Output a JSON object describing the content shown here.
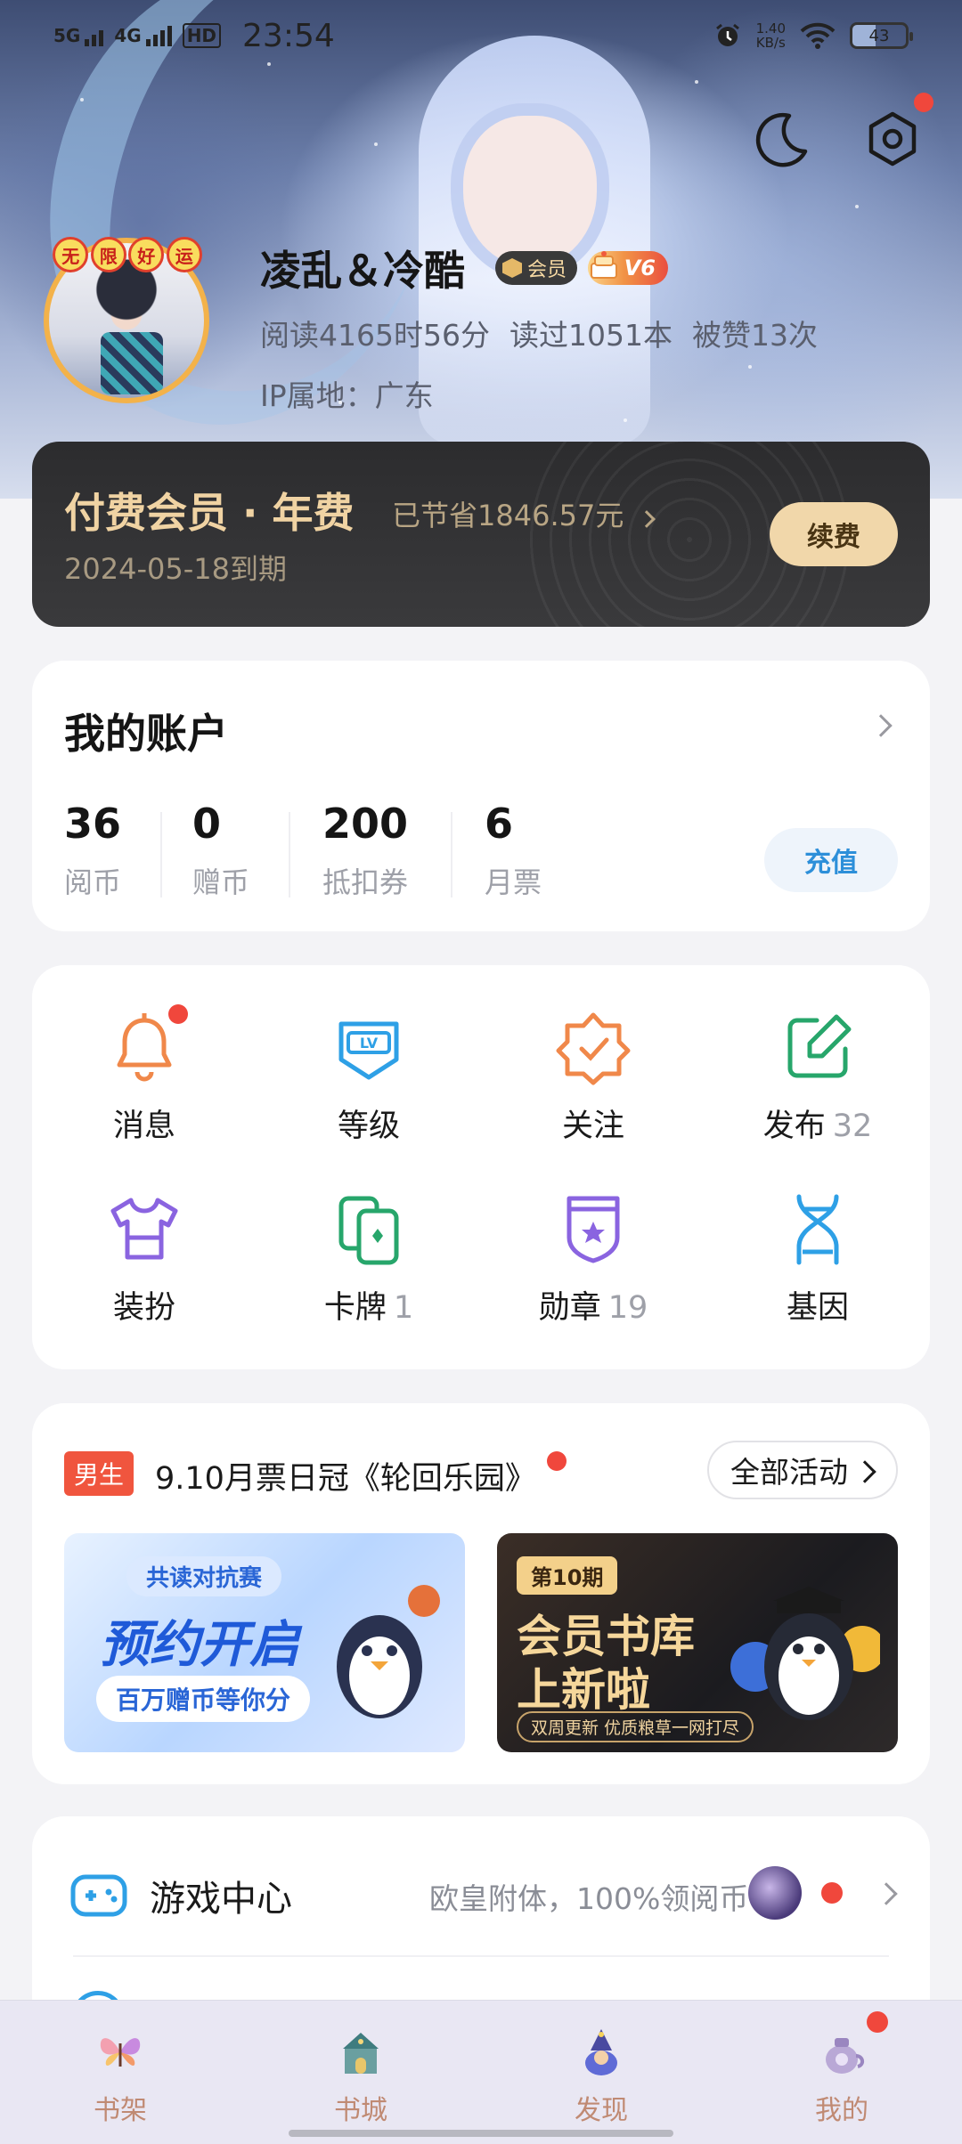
{
  "status_bar": {
    "network1": "5G",
    "network2": "4G",
    "hd": "HD",
    "time": "23:54",
    "speed_value": "1.40",
    "speed_unit": "KB/s",
    "battery": "43"
  },
  "profile": {
    "username": "凌乱＆冷酷",
    "vip_badge": "会员",
    "level_badge": "V6",
    "avatar_frame_chars": [
      "无",
      "限",
      "好",
      "运"
    ],
    "read_time": "阅读4165时56分",
    "books_read": "读过1051本",
    "likes": "被赞13次",
    "ip_location": "IP属地：广东"
  },
  "membership": {
    "title": "付费会员 · 年费",
    "saved": "已节省1846.57元",
    "expire": "2024-05-18到期",
    "renew_label": "续费"
  },
  "account": {
    "title": "我的账户",
    "stats": [
      {
        "value": "36",
        "label": "阅币"
      },
      {
        "value": "0",
        "label": "赠币"
      },
      {
        "value": "200",
        "label": "抵扣券"
      },
      {
        "value": "6",
        "label": "月票"
      }
    ],
    "recharge_label": "充值"
  },
  "features": [
    {
      "label": "消息",
      "count": ""
    },
    {
      "label": "等级",
      "count": ""
    },
    {
      "label": "关注",
      "count": ""
    },
    {
      "label": "发布",
      "count": "32"
    },
    {
      "label": "装扮",
      "count": ""
    },
    {
      "label": "卡牌",
      "count": "1"
    },
    {
      "label": "勋章",
      "count": "19"
    },
    {
      "label": "基因",
      "count": ""
    }
  ],
  "activity": {
    "tag": "男生",
    "headline": "9.10月票日冠《轮回乐园》",
    "all_label": "全部活动",
    "banner_left": {
      "pill": "共读对抗赛",
      "big": "预约开启",
      "sub": "百万赠币等你分"
    },
    "banner_right": {
      "issue": "第10期",
      "big_line1": "会员书库",
      "big_line2": "上新啦",
      "sub": "双周更新  优质粮草一网打尽"
    }
  },
  "game_center": {
    "title": "游戏中心",
    "desc": "欧皇附体，100%领阅币"
  },
  "bottom_nav": [
    {
      "label": "书架"
    },
    {
      "label": "书城"
    },
    {
      "label": "发现"
    },
    {
      "label": "我的"
    }
  ],
  "colors": {
    "accent_blue": "#2d8fd9",
    "red_dot": "#f0473c",
    "gold": "#f0d3a3",
    "nav_label": "#c08a73"
  }
}
